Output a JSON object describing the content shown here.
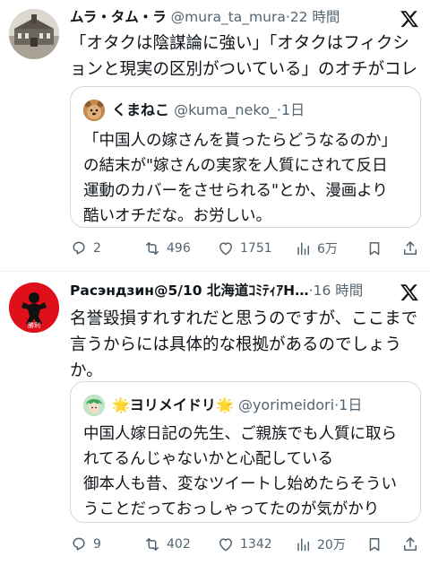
{
  "posts": [
    {
      "author_name": "ムラ・タム・ラ",
      "handle": "@mura_ta_mura",
      "sep": "·",
      "time": "22 時間",
      "text": "「オタクは陰謀論に強い」「オタクはフィクションと現実の区別がついている」のオチがコレ",
      "quote": {
        "author_name": "くまねこ",
        "handle": "@kuma_neko_",
        "sep": "·",
        "time": "1日",
        "text": "「中国人の嫁さんを貰ったらどうなるのか」\nの結末が\"嫁さんの実家を人質にされて反日\n運動のカバーをさせられる\"とか、漫画より\n酷いオチだな。お労しい。"
      },
      "stats": {
        "replies": "2",
        "reposts": "496",
        "likes": "1751",
        "views": "6万"
      }
    },
    {
      "author_name": "Расэндзин@5/10 北海道ｺﾐﾃｨｱH…",
      "handle": "",
      "sep": "·",
      "time": "16 時間",
      "text": "名誉毀損すれすれだと思うのですが、ここまで\n言うからには具体的な根拠があるのでしょう\nか。",
      "avatar_label": "勝利",
      "quote": {
        "star_left": "🌟",
        "author_name": "ヨリメイドリ",
        "star_right": "🌟",
        "handle": "@yorimeidori",
        "sep": "·",
        "time": "1日",
        "text": "中国人嫁日記の先生、ご親族でも人質に取ら\nれてるんじゃないかと心配している\n御本人も昔、変なツイートし始めたらそうい\nうことだっておっしゃってたのが気がかり"
      },
      "stats": {
        "replies": "9",
        "reposts": "402",
        "likes": "1342",
        "views": "20万"
      }
    }
  ],
  "colors": {
    "text": "#0f1419",
    "muted": "#536471",
    "border": "#cfd9de",
    "divider": "#eff3f4"
  },
  "icons": [
    "reply-icon",
    "repost-icon",
    "like-icon",
    "views-icon",
    "bookmark-icon",
    "share-icon",
    "x-logo-icon"
  ]
}
